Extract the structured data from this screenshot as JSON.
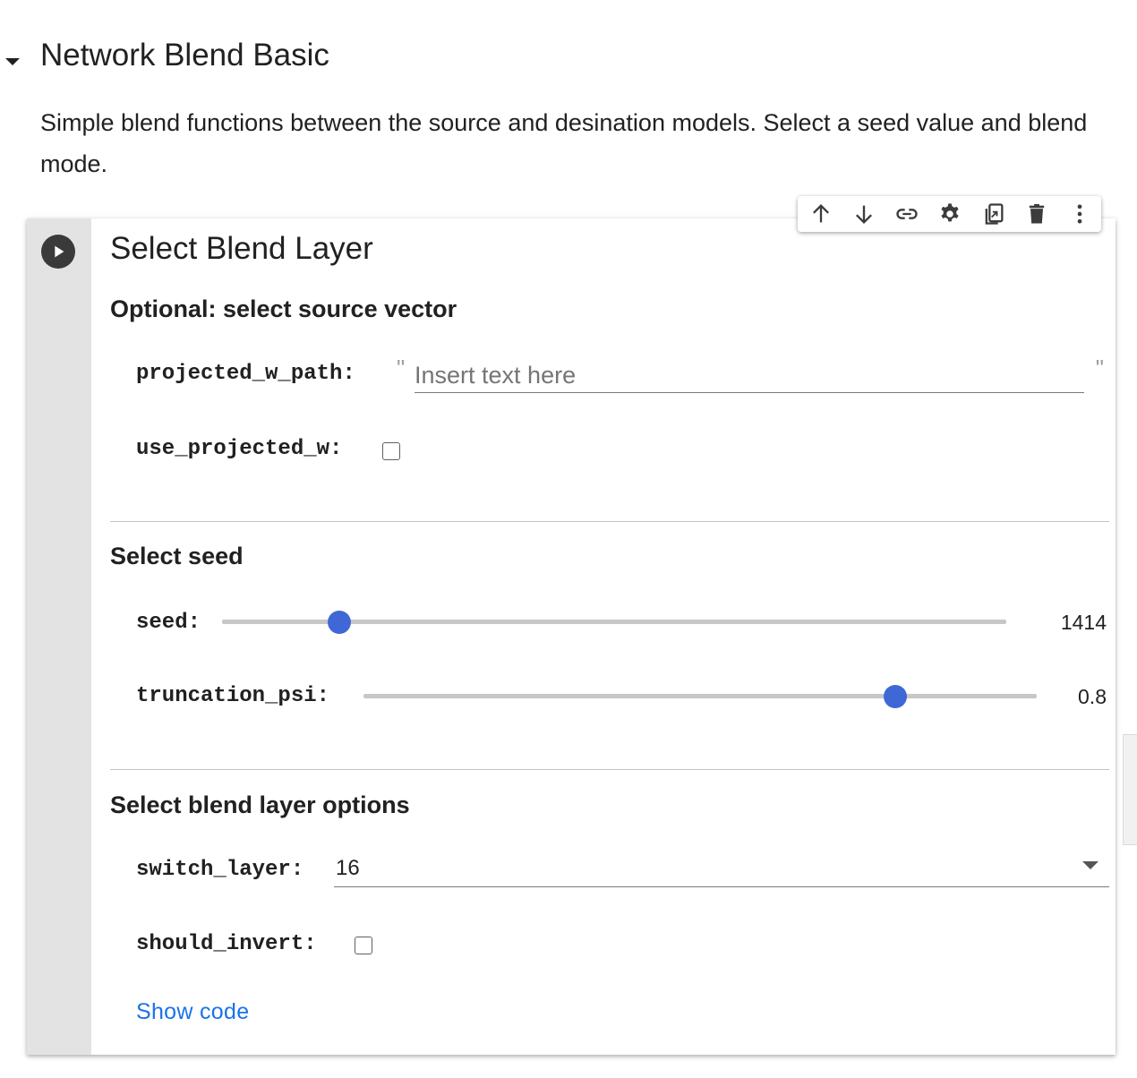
{
  "section": {
    "title": "Network Blend Basic",
    "description": "Simple blend functions between the source and desination models. Select a seed value and blend mode."
  },
  "toolbar": {
    "icons": [
      "arrow-up-icon",
      "arrow-down-icon",
      "link-icon",
      "gear-icon",
      "mirror-cell-icon",
      "trash-icon",
      "more-vert-icon"
    ]
  },
  "cell": {
    "form_title": "Select Blend Layer",
    "source_vector": {
      "heading": "Optional: select source vector",
      "projected_w_path": {
        "label": "projected_w_path:",
        "value": "",
        "placeholder": "Insert text here",
        "quote_open": "\"",
        "quote_close": "\""
      },
      "use_projected_w": {
        "label": "use_projected_w:",
        "checked": false
      }
    },
    "seed_section": {
      "heading": "Select seed",
      "seed": {
        "label": "seed:",
        "value": "1414",
        "fraction": 0.15
      },
      "truncation_psi": {
        "label": "truncation_psi:",
        "value": "0.8",
        "fraction": 0.79
      }
    },
    "blend_options": {
      "heading": "Select blend layer options",
      "switch_layer": {
        "label": "switch_layer:",
        "value": "16"
      },
      "should_invert": {
        "label": "should_invert:",
        "checked": false
      }
    },
    "show_code": "Show code"
  },
  "colors": {
    "accent": "#3f67d6",
    "link": "#1a73e8",
    "gutter": "#e3e3e3",
    "run_button": "#3a3a3a"
  }
}
